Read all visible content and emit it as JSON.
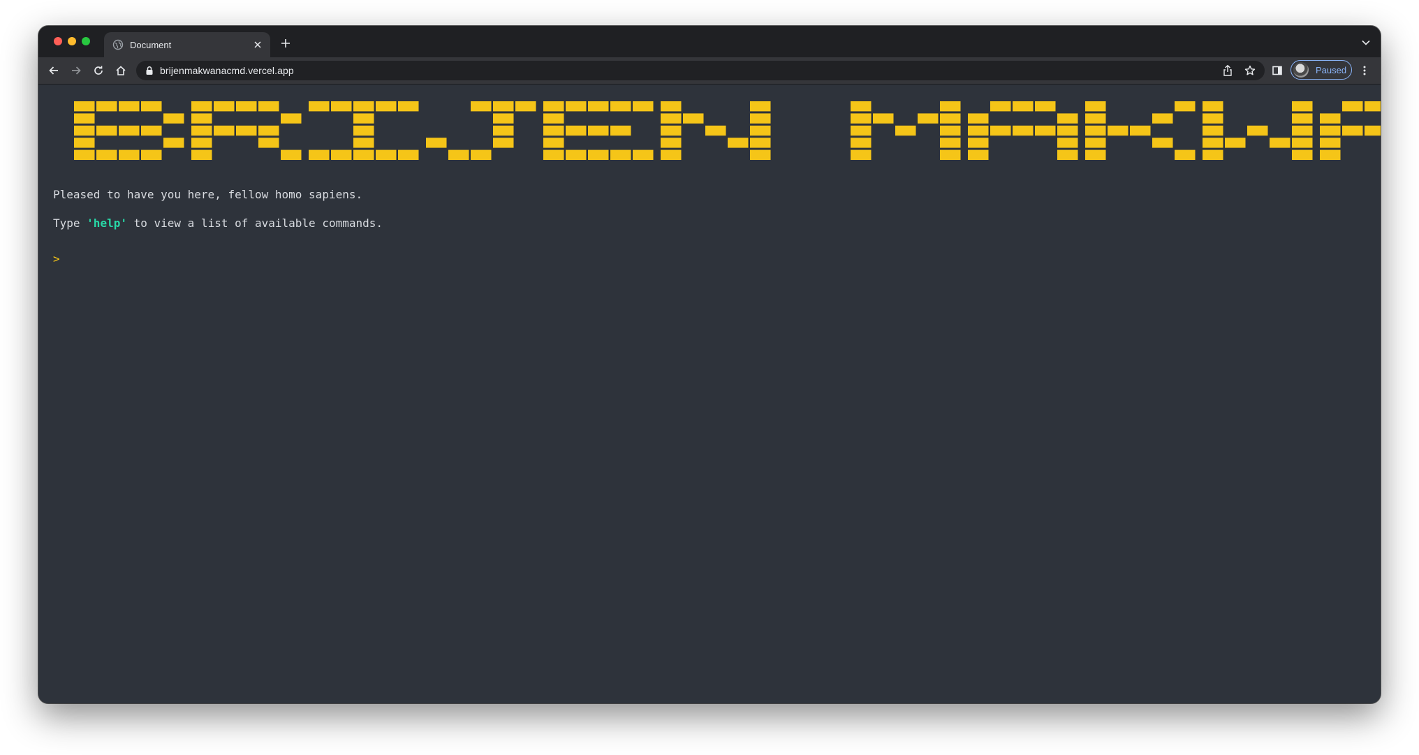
{
  "browser": {
    "tab": {
      "title": "Document",
      "favicon": "globe-icon"
    },
    "url": "brijenmakwanacmd.vercel.app",
    "profile_status": "Paused",
    "accent_color": "#8ab4f8"
  },
  "terminal": {
    "banner": {
      "text": "BRIJEN MAKWANA",
      "color": "#f5c518"
    },
    "welcome": "Pleased to have you here, fellow homo sapiens.",
    "help_line": {
      "prefix": "Type ",
      "command": "'help'",
      "suffix": " to view a list of available commands."
    },
    "prompt_symbol": ">",
    "prompt_value": "",
    "colors": {
      "background": "#2e333b",
      "text": "#d8dbe0",
      "command": "#28d9a7",
      "prompt": "#f5c518"
    }
  }
}
